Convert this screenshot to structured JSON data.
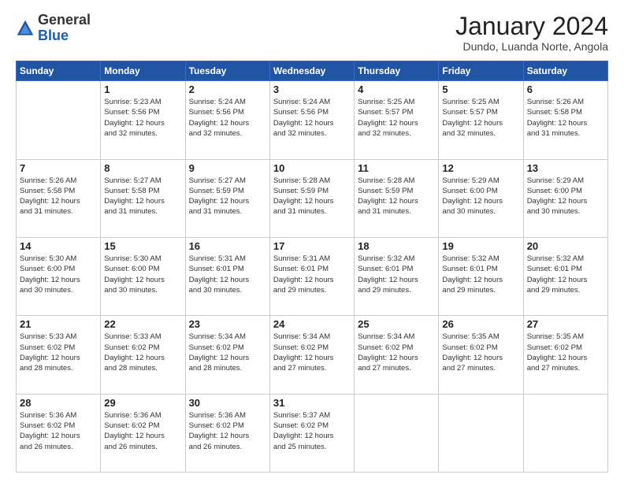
{
  "logo": {
    "general": "General",
    "blue": "Blue"
  },
  "header": {
    "month": "January 2024",
    "location": "Dundo, Luanda Norte, Angola"
  },
  "weekdays": [
    "Sunday",
    "Monday",
    "Tuesday",
    "Wednesday",
    "Thursday",
    "Friday",
    "Saturday"
  ],
  "weeks": [
    [
      {
        "day": "",
        "info": ""
      },
      {
        "day": "1",
        "info": "Sunrise: 5:23 AM\nSunset: 5:56 PM\nDaylight: 12 hours\nand 32 minutes."
      },
      {
        "day": "2",
        "info": "Sunrise: 5:24 AM\nSunset: 5:56 PM\nDaylight: 12 hours\nand 32 minutes."
      },
      {
        "day": "3",
        "info": "Sunrise: 5:24 AM\nSunset: 5:56 PM\nDaylight: 12 hours\nand 32 minutes."
      },
      {
        "day": "4",
        "info": "Sunrise: 5:25 AM\nSunset: 5:57 PM\nDaylight: 12 hours\nand 32 minutes."
      },
      {
        "day": "5",
        "info": "Sunrise: 5:25 AM\nSunset: 5:57 PM\nDaylight: 12 hours\nand 32 minutes."
      },
      {
        "day": "6",
        "info": "Sunrise: 5:26 AM\nSunset: 5:58 PM\nDaylight: 12 hours\nand 31 minutes."
      }
    ],
    [
      {
        "day": "7",
        "info": "Sunrise: 5:26 AM\nSunset: 5:58 PM\nDaylight: 12 hours\nand 31 minutes."
      },
      {
        "day": "8",
        "info": "Sunrise: 5:27 AM\nSunset: 5:58 PM\nDaylight: 12 hours\nand 31 minutes."
      },
      {
        "day": "9",
        "info": "Sunrise: 5:27 AM\nSunset: 5:59 PM\nDaylight: 12 hours\nand 31 minutes."
      },
      {
        "day": "10",
        "info": "Sunrise: 5:28 AM\nSunset: 5:59 PM\nDaylight: 12 hours\nand 31 minutes."
      },
      {
        "day": "11",
        "info": "Sunrise: 5:28 AM\nSunset: 5:59 PM\nDaylight: 12 hours\nand 31 minutes."
      },
      {
        "day": "12",
        "info": "Sunrise: 5:29 AM\nSunset: 6:00 PM\nDaylight: 12 hours\nand 30 minutes."
      },
      {
        "day": "13",
        "info": "Sunrise: 5:29 AM\nSunset: 6:00 PM\nDaylight: 12 hours\nand 30 minutes."
      }
    ],
    [
      {
        "day": "14",
        "info": "Sunrise: 5:30 AM\nSunset: 6:00 PM\nDaylight: 12 hours\nand 30 minutes."
      },
      {
        "day": "15",
        "info": "Sunrise: 5:30 AM\nSunset: 6:00 PM\nDaylight: 12 hours\nand 30 minutes."
      },
      {
        "day": "16",
        "info": "Sunrise: 5:31 AM\nSunset: 6:01 PM\nDaylight: 12 hours\nand 30 minutes."
      },
      {
        "day": "17",
        "info": "Sunrise: 5:31 AM\nSunset: 6:01 PM\nDaylight: 12 hours\nand 29 minutes."
      },
      {
        "day": "18",
        "info": "Sunrise: 5:32 AM\nSunset: 6:01 PM\nDaylight: 12 hours\nand 29 minutes."
      },
      {
        "day": "19",
        "info": "Sunrise: 5:32 AM\nSunset: 6:01 PM\nDaylight: 12 hours\nand 29 minutes."
      },
      {
        "day": "20",
        "info": "Sunrise: 5:32 AM\nSunset: 6:01 PM\nDaylight: 12 hours\nand 29 minutes."
      }
    ],
    [
      {
        "day": "21",
        "info": "Sunrise: 5:33 AM\nSunset: 6:02 PM\nDaylight: 12 hours\nand 28 minutes."
      },
      {
        "day": "22",
        "info": "Sunrise: 5:33 AM\nSunset: 6:02 PM\nDaylight: 12 hours\nand 28 minutes."
      },
      {
        "day": "23",
        "info": "Sunrise: 5:34 AM\nSunset: 6:02 PM\nDaylight: 12 hours\nand 28 minutes."
      },
      {
        "day": "24",
        "info": "Sunrise: 5:34 AM\nSunset: 6:02 PM\nDaylight: 12 hours\nand 27 minutes."
      },
      {
        "day": "25",
        "info": "Sunrise: 5:34 AM\nSunset: 6:02 PM\nDaylight: 12 hours\nand 27 minutes."
      },
      {
        "day": "26",
        "info": "Sunrise: 5:35 AM\nSunset: 6:02 PM\nDaylight: 12 hours\nand 27 minutes."
      },
      {
        "day": "27",
        "info": "Sunrise: 5:35 AM\nSunset: 6:02 PM\nDaylight: 12 hours\nand 27 minutes."
      }
    ],
    [
      {
        "day": "28",
        "info": "Sunrise: 5:36 AM\nSunset: 6:02 PM\nDaylight: 12 hours\nand 26 minutes."
      },
      {
        "day": "29",
        "info": "Sunrise: 5:36 AM\nSunset: 6:02 PM\nDaylight: 12 hours\nand 26 minutes."
      },
      {
        "day": "30",
        "info": "Sunrise: 5:36 AM\nSunset: 6:02 PM\nDaylight: 12 hours\nand 26 minutes."
      },
      {
        "day": "31",
        "info": "Sunrise: 5:37 AM\nSunset: 6:02 PM\nDaylight: 12 hours\nand 25 minutes."
      },
      {
        "day": "",
        "info": ""
      },
      {
        "day": "",
        "info": ""
      },
      {
        "day": "",
        "info": ""
      }
    ]
  ]
}
